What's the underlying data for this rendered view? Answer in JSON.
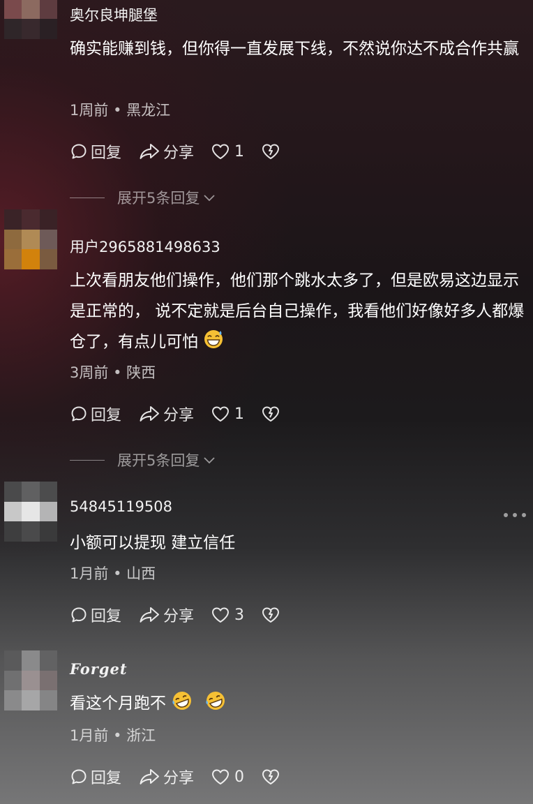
{
  "comments": [
    {
      "username": "奥尔良坤腿堡",
      "text": "确实能赚到钱，但你得一直发展下线，不然说你达不成合作共赢",
      "time": "1周前",
      "location": "黑龙江",
      "reply_label": "回复",
      "share_label": "分享",
      "likes": "1",
      "expand_label": "展开5条回复"
    },
    {
      "username": "用户2965881498633",
      "text": "上次看朋友他们操作，他们那个跳水太多了，但是欧易这边显示是正常的， 说不定就是后台自己操作，我看他们好像好多人都爆仓了，有点儿可怕",
      "time": "3周前",
      "location": "陕西",
      "reply_label": "回复",
      "share_label": "分享",
      "likes": "1",
      "expand_label": "展开5条回复"
    },
    {
      "username": "54845119508",
      "text": "小额可以提现 建立信任",
      "time": "1月前",
      "location": "山西",
      "reply_label": "回复",
      "share_label": "分享",
      "likes": "3"
    },
    {
      "username": "Forget",
      "text": "看这个月跑不",
      "time": "1月前",
      "location": "浙江",
      "reply_label": "回复",
      "share_label": "分享",
      "likes": "0"
    }
  ],
  "separator": "•",
  "icons": {
    "reply": "speech-bubble-icon",
    "share": "share-arrow-icon",
    "like": "heart-icon",
    "dislike": "broken-heart-icon",
    "expand": "chevron-down-icon",
    "more": "more-dots-icon",
    "emoji_2": "grinning-sweat-emoji",
    "emoji_4": "rolling-laughing-emoji"
  }
}
